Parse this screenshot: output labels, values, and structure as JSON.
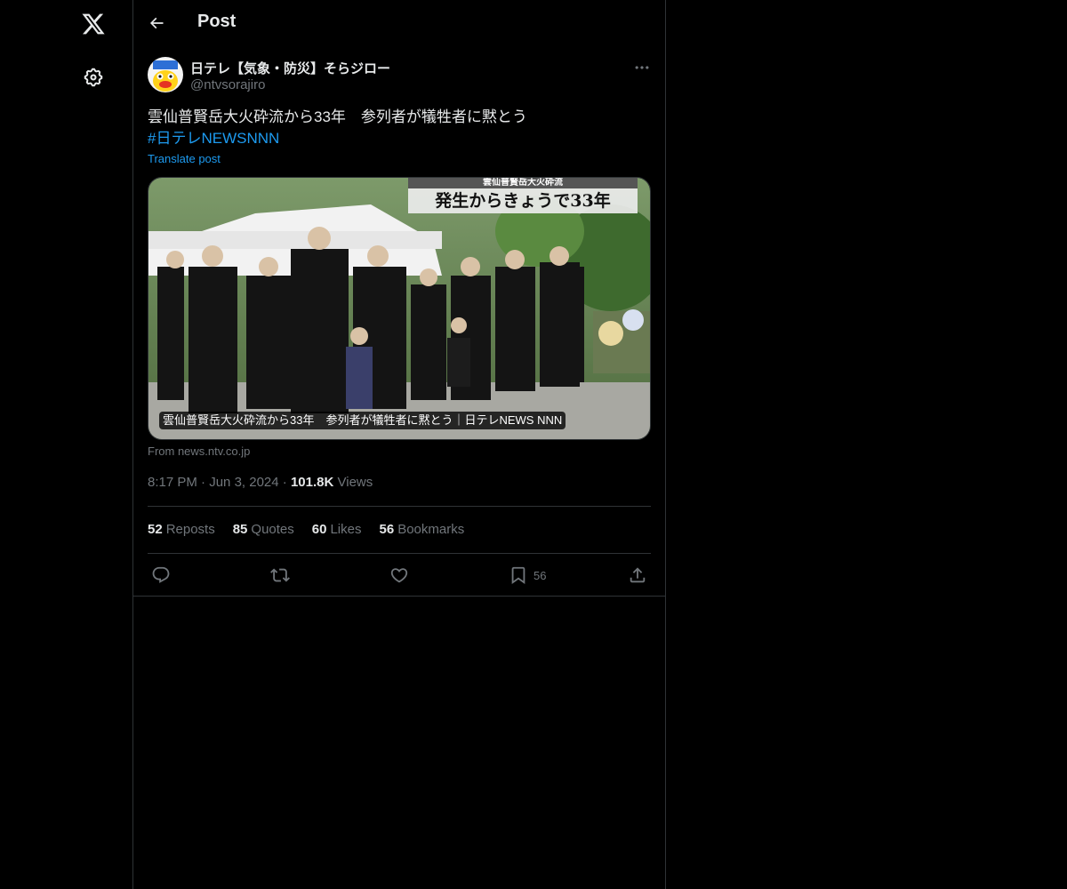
{
  "nav": {
    "logo_icon": "x-logo-icon",
    "settings_icon": "gear-icon"
  },
  "header": {
    "title": "Post"
  },
  "post": {
    "author_name": "日テレ【気象・防災】そらジロー",
    "author_handle": "@ntvsorajiro",
    "text": "雲仙普賢岳大火砕流から33年　参列者が犠牲者に黙とう",
    "hashtag": "#日テレNEWSNNN",
    "translate_label": "Translate post",
    "media": {
      "banner_top": "雲仙普賢岳大火砕流",
      "banner_main": "発生からきょうで33年",
      "caption": "雲仙普賢岳大火砕流から33年　参列者が犠牲者に黙とう｜日テレNEWS NNN"
    },
    "source": "From news.ntv.co.jp",
    "time": "8:17 PM",
    "date": "Jun 3, 2024",
    "views_count": "101.8K",
    "views_label": "Views"
  },
  "stats": {
    "reposts_count": "52",
    "reposts_label": "Reposts",
    "quotes_count": "85",
    "quotes_label": "Quotes",
    "likes_count": "60",
    "likes_label": "Likes",
    "bookmarks_count": "56",
    "bookmarks_label": "Bookmarks"
  },
  "actions": {
    "bookmark_count": "56"
  },
  "colors": {
    "background": "#000000",
    "text": "#e7e9ea",
    "muted": "#71767b",
    "accent": "#1d9bf0",
    "border": "#2f3336"
  }
}
